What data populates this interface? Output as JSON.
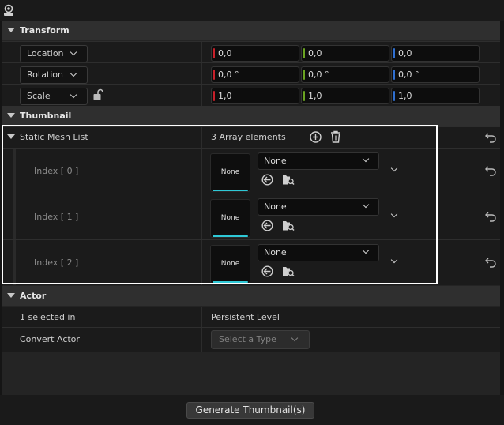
{
  "sections": {
    "transform": "Transform",
    "thumbnail": "Thumbnail",
    "actor": "Actor"
  },
  "transform": {
    "location": {
      "label": "Location",
      "x": "0,0",
      "y": "0,0",
      "z": "0,0"
    },
    "rotation": {
      "label": "Rotation",
      "x": "0,0 °",
      "y": "0,0 °",
      "z": "0,0 °"
    },
    "scale": {
      "label": "Scale",
      "x": "1,0",
      "y": "1,0",
      "z": "1,0"
    }
  },
  "thumbnail": {
    "static_mesh_list": {
      "label": "Static Mesh List",
      "count_text": "3 Array elements",
      "items": [
        {
          "index_label": "Index [ 0 ]",
          "thumb": "None",
          "asset": "None"
        },
        {
          "index_label": "Index [ 1 ]",
          "thumb": "None",
          "asset": "None"
        },
        {
          "index_label": "Index [ 2 ]",
          "thumb": "None",
          "asset": "None"
        }
      ]
    }
  },
  "actor": {
    "selected_label": "1 selected in",
    "selected_value": "Persistent Level",
    "convert_label": "Convert Actor",
    "convert_placeholder": "Select a Type"
  },
  "footer": {
    "generate_button": "Generate Thumbnail(s)"
  },
  "colors": {
    "x_axis": "#c8202a",
    "y_axis": "#6aa321",
    "z_axis": "#2f6fd0",
    "accent": "#2ec8d6",
    "highlight_border": "#ffffff"
  }
}
